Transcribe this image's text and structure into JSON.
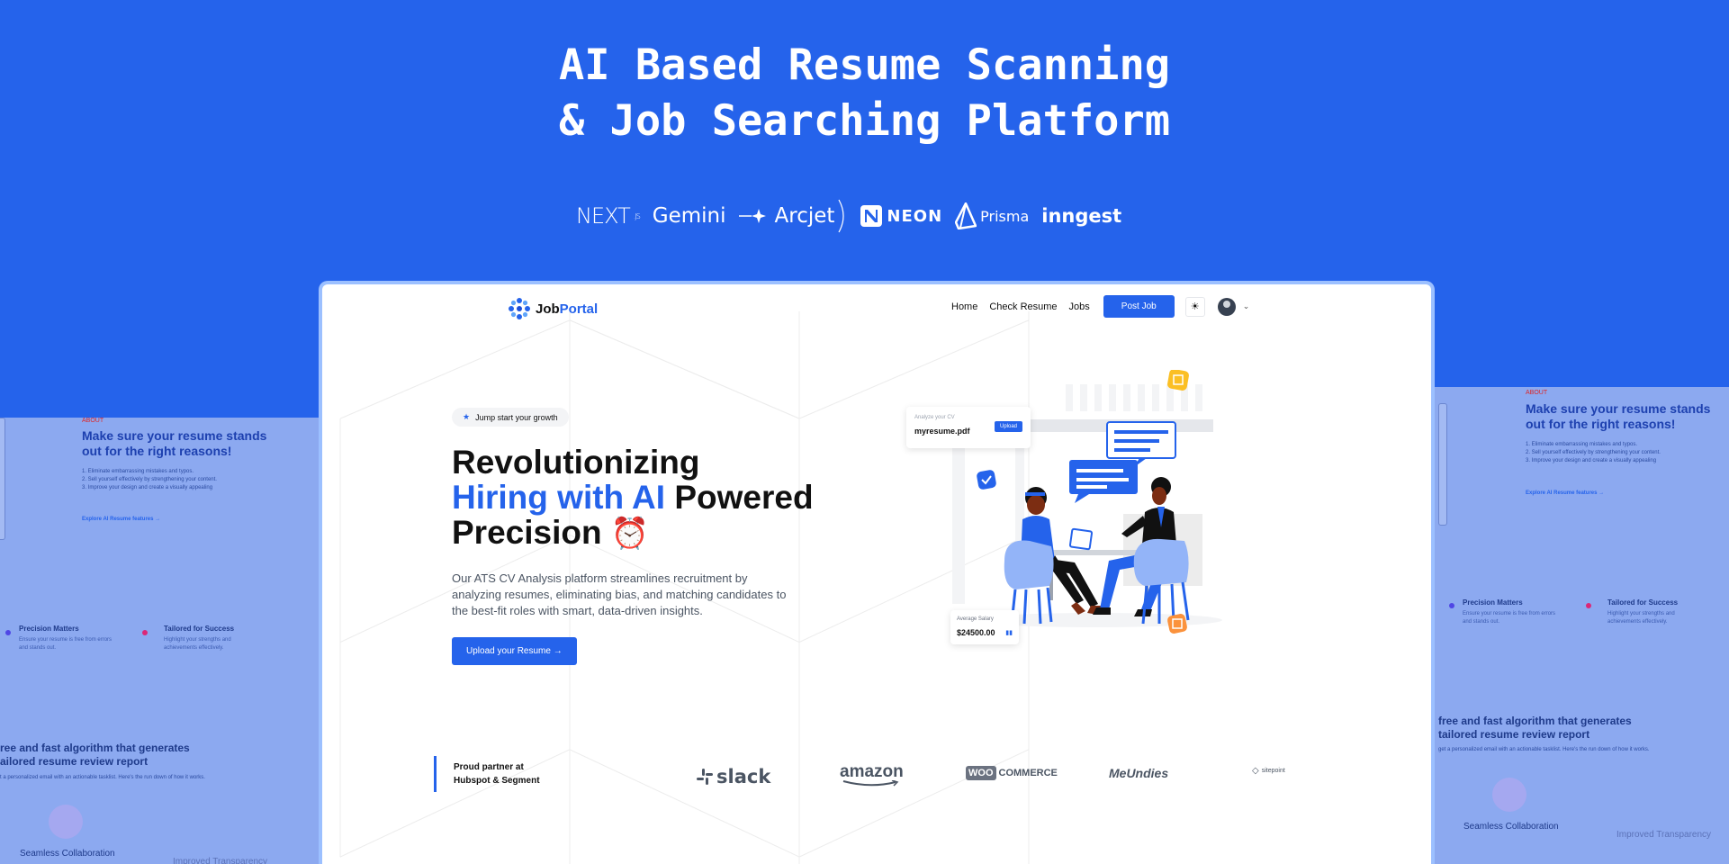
{
  "banner": {
    "title_line1": "AI Based Resume Scanning",
    "title_line2": "& Job Searching Platform",
    "tech_stack": [
      {
        "name": "NEXT",
        "suffix": ".JS",
        "icon": "nextjs-logo"
      },
      {
        "name": "Gemini",
        "icon": "gemini-logo"
      },
      {
        "name": "Arcjet",
        "icon": "arcjet-logo"
      },
      {
        "name": "NEON",
        "icon": "neon-logo"
      },
      {
        "name": "Prisma",
        "icon": "prisma-logo"
      },
      {
        "name": "inngest",
        "icon": "inngest-logo"
      }
    ]
  },
  "app": {
    "brand_prefix": "Job",
    "brand_suffix": "Portal",
    "logo_icon": "jobportal-logo-icon",
    "nav": {
      "links": [
        "Home",
        "Check Resume",
        "Jobs"
      ],
      "post_job": "Post Job",
      "theme_icon": "sun-icon",
      "avatar_icon": "user-avatar",
      "menu_icon": "chevron-down-icon"
    },
    "hero": {
      "pill_icon": "star-icon",
      "pill": "Jump start your growth",
      "heading_1": "Revolutionizing",
      "heading_2_blue": "Hiring with AI",
      "heading_2_rest": " Powered",
      "heading_3": "Precision",
      "heading_emoji": "⏰",
      "description": "Our ATS CV Analysis platform streamlines recruitment by analyzing resumes, eliminating bias, and matching candidates to the best-fit roles with smart, data-driven insights.",
      "cta": "Upload your Resume →"
    },
    "upload_card": {
      "label": "Analyze your CV",
      "file": "myresume.pdf",
      "button": "Upload"
    },
    "salary_card": {
      "label": "Average Salary",
      "value": "$24500.00",
      "icon": "bar-chart-icon"
    },
    "partners": {
      "label_line1": "Proud partner at",
      "label_line2": "Hubspot & Segment",
      "brands": [
        "slack",
        "amazon",
        "WOO",
        "COMMERCE",
        "MeUndies",
        "sitepoint"
      ]
    }
  },
  "side_panel": {
    "about": "ABOUT",
    "heading": "Make sure your resume stands out for the right reasons!",
    "list": [
      "1. Eliminate embarrassing mistakes and typos.",
      "2. Sell yourself effectively by strengthening your content.",
      "3. Improve your design and create a visually appealing"
    ],
    "link": "Explore AI Resume features →",
    "feature_1_title": "Precision Matters",
    "feature_1_desc": "Ensure your resume is free from errors and stands out.",
    "feature_2_title": "Tailored for Success",
    "feature_2_desc": "Highlight your strengths and achievements effectively.",
    "algo_heading_left": "ree and fast algorithm that generates ailored resume review report",
    "algo_heading_right": "free and fast algorithm that generates tailored resume review report",
    "algo_desc_left": "t a personalized email with an actionable tasklist. Here's the run down of how it works.",
    "algo_desc_right": "get a personalized email with an actionable tasklist. Here's the run down of how it works.",
    "caption_1": "Seamless Collaboration",
    "caption_2": "Improved Transparency"
  },
  "colors": {
    "primary": "#2563eb",
    "banner_bg": "#2563eb",
    "side_bg": "#8ca9f0",
    "heading_text": "#111111",
    "body_text": "#4b5563"
  }
}
